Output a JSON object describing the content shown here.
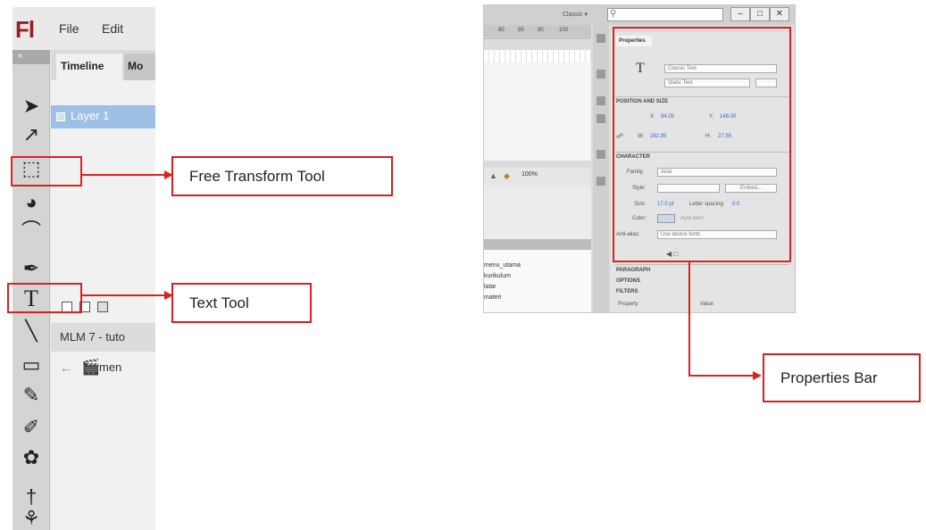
{
  "left_window": {
    "logo": "Fl",
    "menu": [
      "File",
      "Edit"
    ],
    "toolbar_header": "«",
    "timeline": {
      "tab_timeline": "Timeline",
      "tab_motion": "Mo",
      "layer_label": "Layer 1"
    },
    "document_tab": "MLM 7 - tuto",
    "scene_label": "men"
  },
  "tools": [
    {
      "name": "selection-tool-icon",
      "glyph": "➤"
    },
    {
      "name": "subselection-tool-icon",
      "glyph": "↗"
    },
    {
      "name": "free-transform-tool-icon",
      "glyph": "⬚"
    },
    {
      "name": "3d-rotation-tool-icon",
      "glyph": "◕"
    },
    {
      "name": "lasso-tool-icon",
      "glyph": "⌒"
    },
    {
      "name": "pen-tool-icon",
      "glyph": "✒"
    },
    {
      "name": "text-tool-icon",
      "glyph": "T"
    },
    {
      "name": "line-tool-icon",
      "glyph": "╲"
    },
    {
      "name": "rectangle-tool-icon",
      "glyph": "▭"
    },
    {
      "name": "pencil-tool-icon",
      "glyph": "✎"
    },
    {
      "name": "brush-tool-icon",
      "glyph": "✐"
    },
    {
      "name": "deco-tool-icon",
      "glyph": "✿"
    },
    {
      "name": "bone-tool-icon",
      "glyph": "†"
    },
    {
      "name": "paint-bucket-tool-icon",
      "glyph": "⚘"
    }
  ],
  "callouts": {
    "free_transform": "Free Transform Tool",
    "text_tool": "Text Tool",
    "properties_bar": "Properties Bar"
  },
  "right_window": {
    "workspace": "Classic ▾",
    "window_buttons": [
      "–",
      "□",
      "✕"
    ],
    "ruler": [
      "80",
      "85",
      "90",
      "100"
    ],
    "zoom": "100%",
    "library_items": [
      "menu_utama",
      "kurikulum",
      "latar",
      "materi"
    ],
    "properties": {
      "tab": "Properties",
      "text_engine": "Classic Text",
      "text_type": "Static Text",
      "section_position": "POSITION AND SIZE",
      "x_label": "X:",
      "x_value": "94.05",
      "y_label": "Y:",
      "y_value": "148.00",
      "w_label": "W:",
      "w_value": "282.95",
      "h_label": "H:",
      "h_value": "27.55",
      "section_character": "CHARACTER",
      "family_label": "Family:",
      "family_value": "Arial",
      "style_label": "Style:",
      "style_button": "Embed...",
      "size_label": "Size:",
      "size_value": "17.0 pt",
      "letter_spacing_label": "Letter spacing:",
      "letter_spacing_value": "0.0",
      "color_label": "Color:",
      "auto_kern": "Auto kern",
      "antialias_label": "Anti-alias:",
      "antialias_value": "Use device fonts",
      "section_paragraph": "PARAGRAPH",
      "section_options": "OPTIONS",
      "section_filters": "FILTERS",
      "filters_col_property": "Property",
      "filters_col_value": "Value"
    }
  }
}
